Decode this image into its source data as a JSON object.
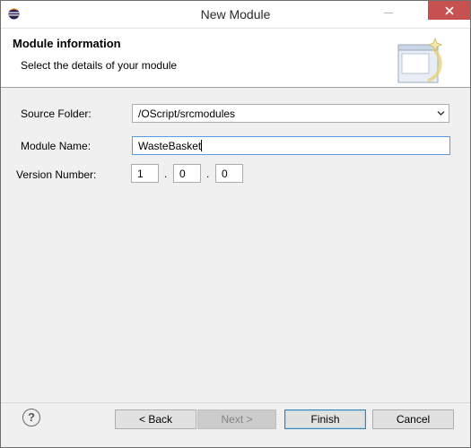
{
  "window": {
    "title": "New Module"
  },
  "header": {
    "title": "Module information",
    "description": "Select the details of your module"
  },
  "form": {
    "source_folder": {
      "label": "Source Folder:",
      "value": "/OScript/srcmodules"
    },
    "module_name": {
      "label": "Module Name:",
      "value": "WasteBasket"
    },
    "version_number": {
      "label": "Version Number:",
      "major": "1",
      "minor": "0",
      "patch": "0",
      "separator": "."
    }
  },
  "footer": {
    "help_glyph": "?",
    "back_label": "< Back",
    "next_label": "Next >",
    "finish_label": "Finish",
    "cancel_label": "Cancel"
  },
  "colors": {
    "close_button": "#c75050",
    "focus_border": "#569de5",
    "default_button_border": "#3c7fb1"
  },
  "icons": {
    "app": "eclipse-icon",
    "banner": "wizard-window-icon",
    "combo_arrow": "chevron-down-icon",
    "help": "help-icon"
  }
}
